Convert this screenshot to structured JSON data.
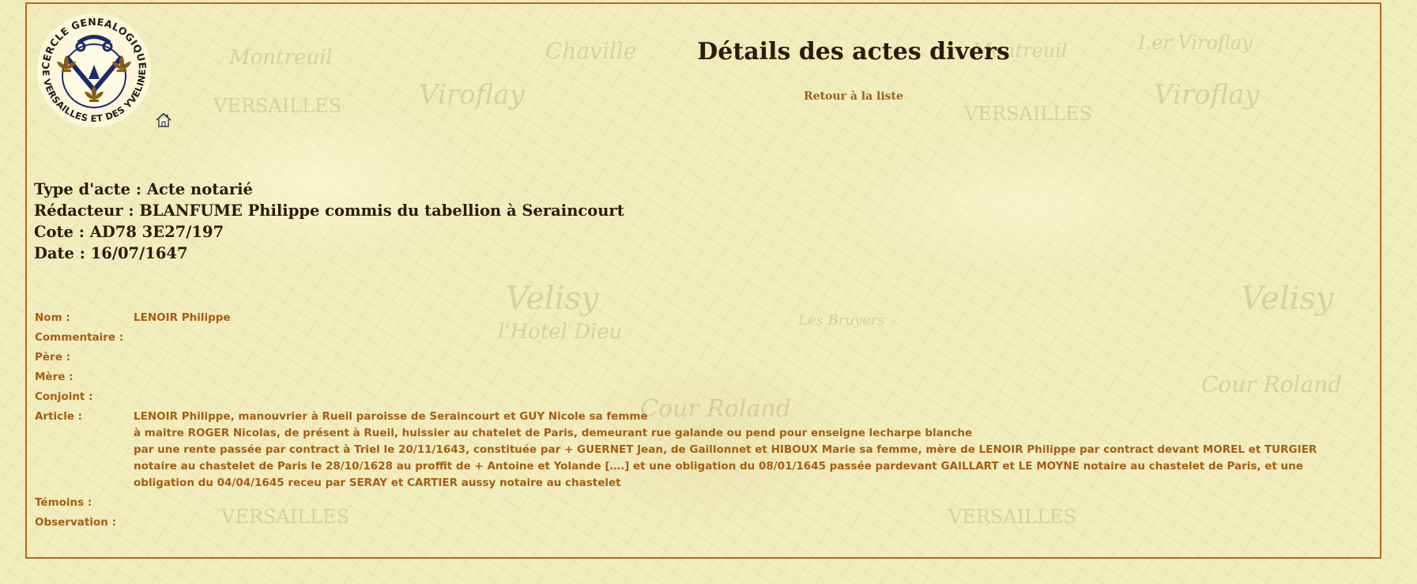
{
  "page": {
    "title": "Détails des actes divers",
    "back_link": "Retour à la liste"
  },
  "logo": {
    "text_top": "CERCLE GENEALOGIQUE",
    "text_bottom": "DE VERSAILLES ET DES YVELINES",
    "icon": "fleur-de-lis-shield-icon"
  },
  "home_icon": "home-icon",
  "acte": {
    "type": "Type d'acte : Acte notarié",
    "redacteur": "Rédacteur : BLANFUME Philippe commis du tabellion à Seraincourt",
    "cote": "Cote : AD78 3E27/197",
    "date": "Date : 16/07/1647"
  },
  "fields": [
    {
      "label": "Nom :",
      "value": "LENOIR Philippe"
    },
    {
      "label": "Commentaire :",
      "value": ""
    },
    {
      "label": "Père :",
      "value": ""
    },
    {
      "label": "Mère :",
      "value": ""
    },
    {
      "label": "Conjoint :",
      "value": ""
    },
    {
      "label": "Article :",
      "lines": [
        "LENOIR Philippe, manouvrier à Rueil paroisse de Seraincourt et GUY Nicole sa femme",
        "à maitre ROGER Nicolas, de présent à Rueil, huissier au chatelet de Paris, demeurant rue galande ou pend pour enseigne lecharpe blanche",
        "par une rente passée par contract à Triel le 20/11/1643, constituée par + GUERNET Jean, de Gaillonnet et HIBOUX Marie sa femme, mère de LENOIR Philippe par contract devant MOREL et TURGIER notaire au chastelet de Paris le 28/10/1628 au proffit de + Antoine et Yolande [….] et une obligation du 08/01/1645 passée pardevant GAILLART et LE MOYNE notaire au chastelet de Paris, et une obligation du 04/04/1645 receu par SERAY et CARTIER aussy notaire au chastelet"
      ]
    },
    {
      "label": "Témoins :",
      "value": ""
    },
    {
      "label": "Observation :",
      "value": ""
    }
  ],
  "map_words": [
    "Montreuil",
    "Chaville",
    "Viroflay",
    "VERSAILLES",
    "Velisy",
    "l'Hotel Dieu",
    "Cour Roland",
    "I.er Viroflay",
    "Les Bruyers"
  ],
  "colors": {
    "frame": "#b9661f",
    "heading": "#2a1c0c",
    "field_text": "#a85d10",
    "background": "#f2edbd"
  }
}
